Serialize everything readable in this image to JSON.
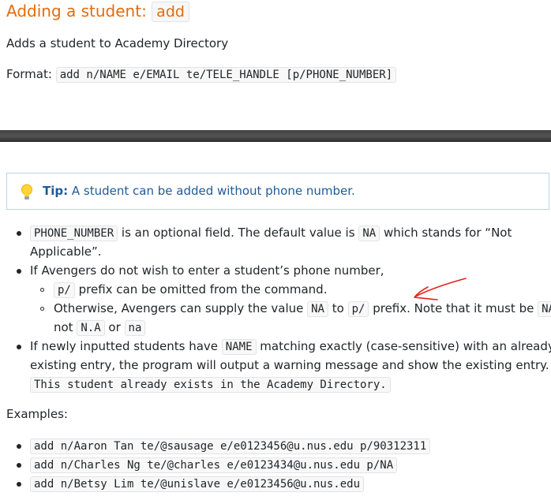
{
  "heading": {
    "text": "Adding a student: ",
    "command": "add"
  },
  "description": "Adds a student to Academy Directory",
  "format": {
    "label": "Format: ",
    "syntax": "add n/NAME e/EMAIL te/TELE_HANDLE [p/PHONE_NUMBER]"
  },
  "tip": {
    "label": "Tip:",
    "text": " A student can be added without phone number."
  },
  "bullets": {
    "b1": {
      "code1": "PHONE_NUMBER",
      "t1": " is an optional field. The default value is ",
      "code2": "NA",
      "t2": " which stands for “Not",
      "t3": "Applicable”."
    },
    "b2": {
      "text": "If Avengers do not wish to enter a student’s phone number,"
    },
    "sub1": {
      "code": "p/",
      "text": " prefix can be omitted from the command."
    },
    "sub2": {
      "t1": "Otherwise, Avengers can supply the value ",
      "code1": "NA",
      "t2": " to ",
      "code2": "p/",
      "t3": " prefix. Note that it must be ",
      "code3": "NA",
      "t4": "not ",
      "code4": "N.A",
      "t5": " or ",
      "code5": "na"
    },
    "b3": {
      "t1": "If newly inputted students have ",
      "code1": "NAME",
      "t2": " matching exactly (case-sensitive) with an already",
      "t3": "existing entry, the program will output a warning message and show the existing entry.",
      "code2": "This student already exists in the Academy Directory."
    }
  },
  "examples": {
    "label": "Examples:",
    "items": [
      "add n/Aaron Tan te/@sausage e/e0123456@u.nus.edu p/90312311",
      "add n/Charles Ng te/@charles e/e0123434@u.nus.edu p/NA",
      "add n/Betsy Lim te/@unislave e/e0123456@u.nus.edu"
    ]
  },
  "icons": {
    "tip": "lightbulb-icon",
    "annotation": "red-arrow-annotation"
  },
  "colors": {
    "heading": "#e46c0a",
    "tip_text": "#1f5a96",
    "tip_border": "#b8d3ea",
    "arrow": "#e0241b"
  }
}
